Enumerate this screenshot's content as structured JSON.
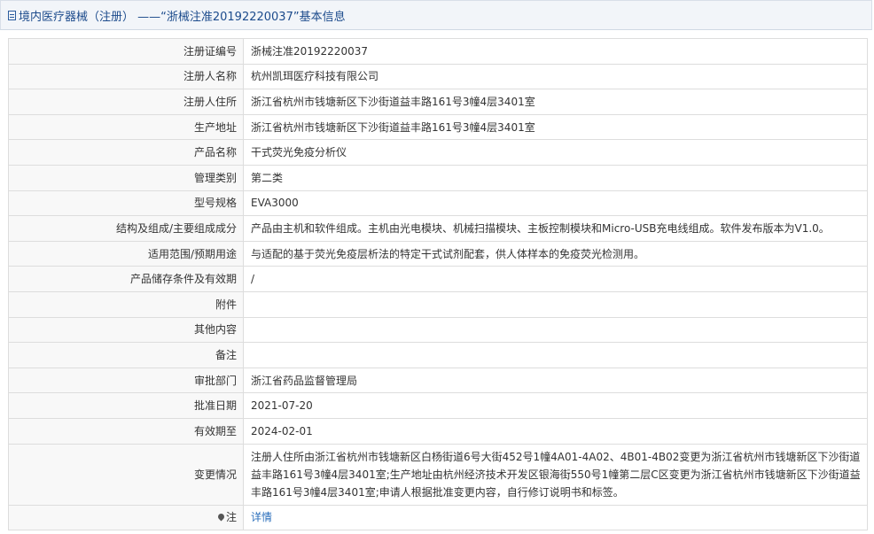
{
  "header": {
    "title": "境内医疗器械（注册） ——“浙械注准20192220037”基本信息"
  },
  "rows": [
    {
      "label": "注册证编号",
      "value": "浙械注准20192220037"
    },
    {
      "label": "注册人名称",
      "value": "杭州凯珥医疗科技有限公司"
    },
    {
      "label": "注册人住所",
      "value": "浙江省杭州市钱塘新区下沙街道益丰路161号3幢4层3401室"
    },
    {
      "label": "生产地址",
      "value": "浙江省杭州市钱塘新区下沙街道益丰路161号3幢4层3401室"
    },
    {
      "label": "产品名称",
      "value": "干式荧光免疫分析仪"
    },
    {
      "label": "管理类别",
      "value": "第二类"
    },
    {
      "label": "型号规格",
      "value": "EVA3000"
    },
    {
      "label": "结构及组成/主要组成成分",
      "value": "产品由主机和软件组成。主机由光电模块、机械扫描模块、主板控制模块和Micro-USB充电线组成。软件发布版本为V1.0。"
    },
    {
      "label": "适用范围/预期用途",
      "value": "与适配的基于荧光免疫层析法的特定干式试剂配套，供人体样本的免疫荧光检测用。"
    },
    {
      "label": "产品储存条件及有效期",
      "value": "/"
    },
    {
      "label": "附件",
      "value": ""
    },
    {
      "label": "其他内容",
      "value": ""
    },
    {
      "label": "备注",
      "value": ""
    },
    {
      "label": "审批部门",
      "value": "浙江省药品监督管理局"
    },
    {
      "label": "批准日期",
      "value": "2021-07-20"
    },
    {
      "label": "有效期至",
      "value": "2024-02-01"
    },
    {
      "label": "变更情况",
      "value": "注册人住所由浙江省杭州市钱塘新区白杨街道6号大街452号1幢4A01-4A02、4B01-4B02变更为浙江省杭州市钱塘新区下沙街道益丰路161号3幢4层3401室;生产地址由杭州经济技术开发区银海街550号1幢第二层C区变更为浙江省杭州市钱塘新区下沙街道益丰路161号3幢4层3401室;申请人根据批准变更内容，自行修订说明书和标签。"
    }
  ],
  "note": {
    "label": "注",
    "icon": "pin-icon",
    "link_text": "详情"
  },
  "colors": {
    "header_bg": "#f2f5f9",
    "title": "#1c4b8c",
    "link": "#2a6ebb",
    "border": "#dddddd"
  }
}
